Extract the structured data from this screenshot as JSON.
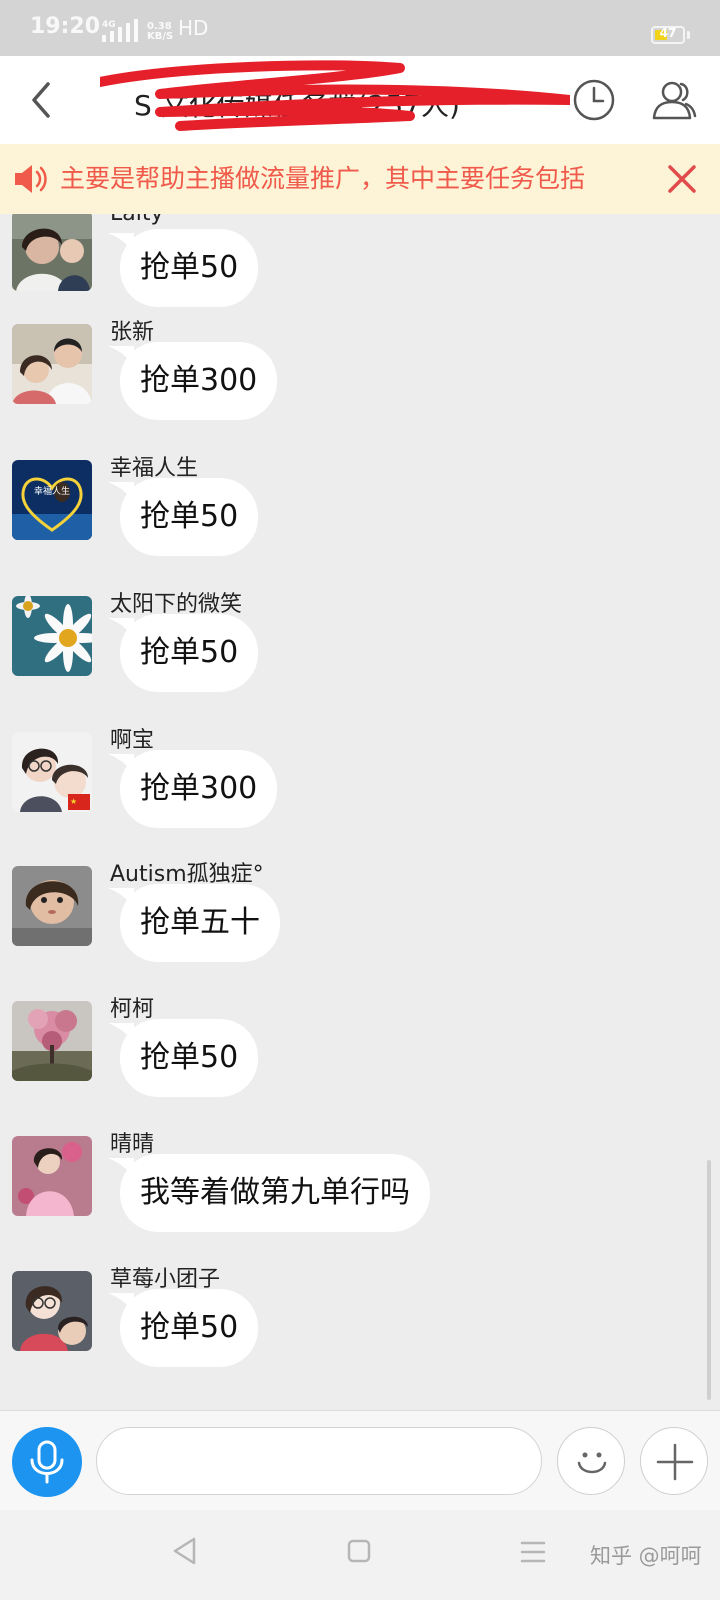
{
  "status_bar": {
    "time": "19:20",
    "network": "4G",
    "speed_value": "0.38",
    "speed_unit": "KB/S",
    "hd": "HD",
    "battery": "47",
    "battery_level": 0.47
  },
  "header": {
    "title": "S 文化传媒任务群(257人)"
  },
  "announcement": {
    "text": "主要是帮助主播做流量推广，其中主要任务包括"
  },
  "messages": [
    {
      "sender": "Laity",
      "text": "抢单50"
    },
    {
      "sender": "张新",
      "text": "抢单300"
    },
    {
      "sender": "幸福人生",
      "text": "抢单50",
      "avatar_text": "幸福人生"
    },
    {
      "sender": "太阳下的微笑",
      "text": "抢单50"
    },
    {
      "sender": "啊宝",
      "text": "抢单300"
    },
    {
      "sender": "Autism孤独症°",
      "text": "抢单五十"
    },
    {
      "sender": "柯柯",
      "text": "抢单50"
    },
    {
      "sender": "晴晴",
      "text": "我等着做第九单行吗"
    },
    {
      "sender": "草莓小团子",
      "text": "抢单50"
    }
  ],
  "input": {
    "value": "",
    "placeholder": ""
  },
  "watermark": "知乎 @呵呵",
  "colors": {
    "accent_blue": "#1d95f0",
    "announce_text": "#ef5a4a",
    "announce_bg": "#fdf3d6",
    "scribble_red": "#e5202a"
  }
}
